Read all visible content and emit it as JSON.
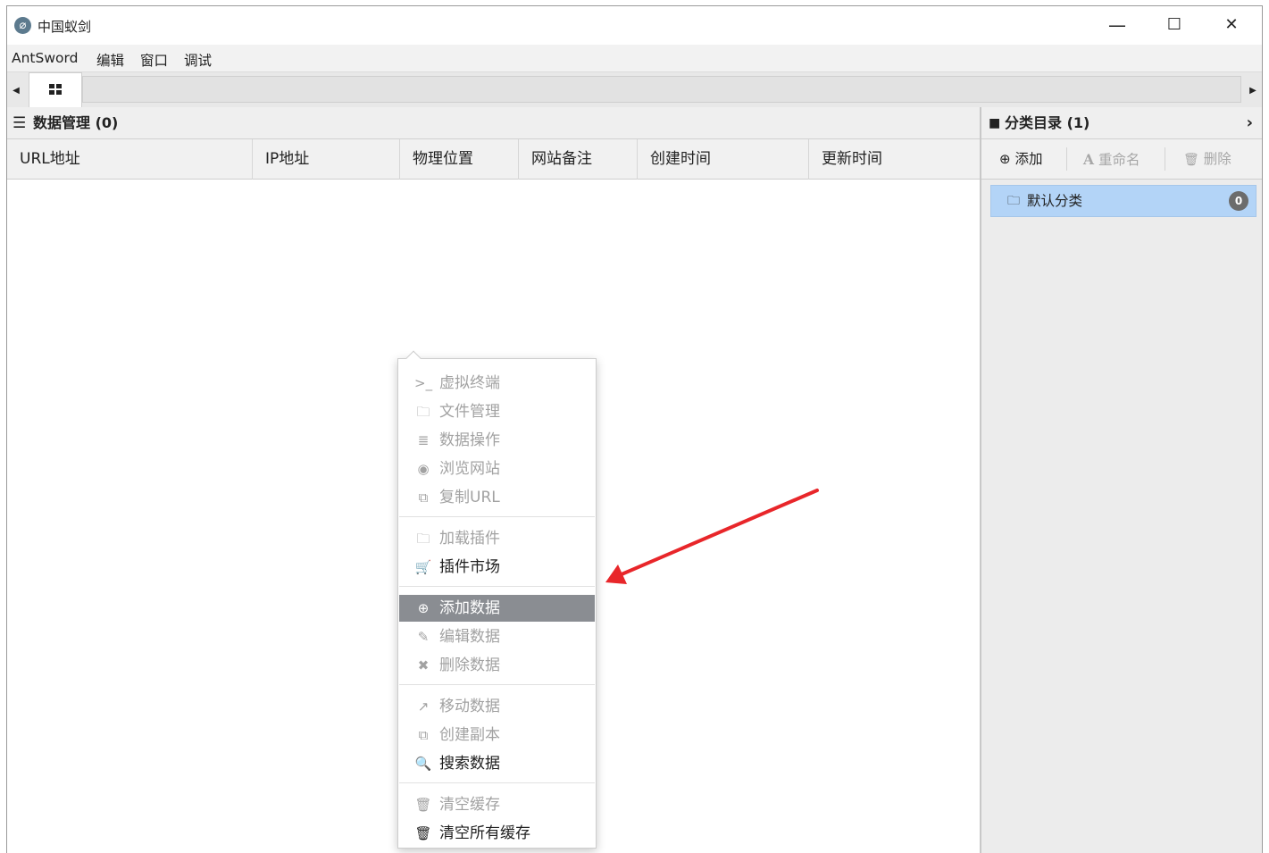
{
  "window": {
    "title": "中国蚁剑",
    "app_icon": "antsword-logo-icon",
    "controls": {
      "minimize": "—",
      "maximize": "☐",
      "close": "✕"
    }
  },
  "menubar": [
    "AntSword",
    "编辑",
    "窗口",
    "调试"
  ],
  "data_panel": {
    "title": "数据管理 (0)",
    "columns": [
      "URL地址",
      "IP地址",
      "物理位置",
      "网站备注",
      "创建时间",
      "更新时间"
    ],
    "rows": []
  },
  "category_panel": {
    "title": "分类目录 (1)",
    "toolbar": {
      "add": "添加",
      "rename": "重命名",
      "delete": "删除"
    },
    "items": [
      {
        "label": "默认分类",
        "count": "0"
      }
    ]
  },
  "context_menu": {
    "groups": [
      [
        {
          "icon": "terminal-icon",
          "glyph": ">_",
          "label": "虚拟终端",
          "enabled": false
        },
        {
          "icon": "folder-icon",
          "glyph": "🗀",
          "label": "文件管理",
          "enabled": false
        },
        {
          "icon": "database-icon",
          "glyph": "≣",
          "label": "数据操作",
          "enabled": false
        },
        {
          "icon": "chrome-icon",
          "glyph": "◉",
          "label": "浏览网站",
          "enabled": false
        },
        {
          "icon": "copy-icon",
          "glyph": "⧉",
          "label": "复制URL",
          "enabled": false
        }
      ],
      [
        {
          "icon": "folder-icon",
          "glyph": "🗀",
          "label": "加载插件",
          "enabled": false
        },
        {
          "icon": "cart-icon",
          "glyph": "🛒",
          "label": "插件市场",
          "enabled": true
        }
      ],
      [
        {
          "icon": "plus-circle-icon",
          "glyph": "⊕",
          "label": "添加数据",
          "enabled": true,
          "highlighted": true
        },
        {
          "icon": "edit-icon",
          "glyph": "✎",
          "label": "编辑数据",
          "enabled": false
        },
        {
          "icon": "times-icon",
          "glyph": "✖",
          "label": "删除数据",
          "enabled": false
        }
      ],
      [
        {
          "icon": "share-square-icon",
          "glyph": "↗",
          "label": "移动数据",
          "enabled": false
        },
        {
          "icon": "copy-icon",
          "glyph": "⧉",
          "label": "创建副本",
          "enabled": false
        },
        {
          "icon": "search-icon",
          "glyph": "🔍",
          "label": "搜索数据",
          "enabled": true
        }
      ],
      [
        {
          "icon": "trash-icon",
          "glyph": "🗑",
          "label": "清空缓存",
          "enabled": false
        },
        {
          "icon": "trash-icon",
          "glyph": "🗑",
          "label": "清空所有缓存",
          "enabled": true
        }
      ]
    ]
  },
  "annotation": {
    "color": "#e8262a"
  }
}
